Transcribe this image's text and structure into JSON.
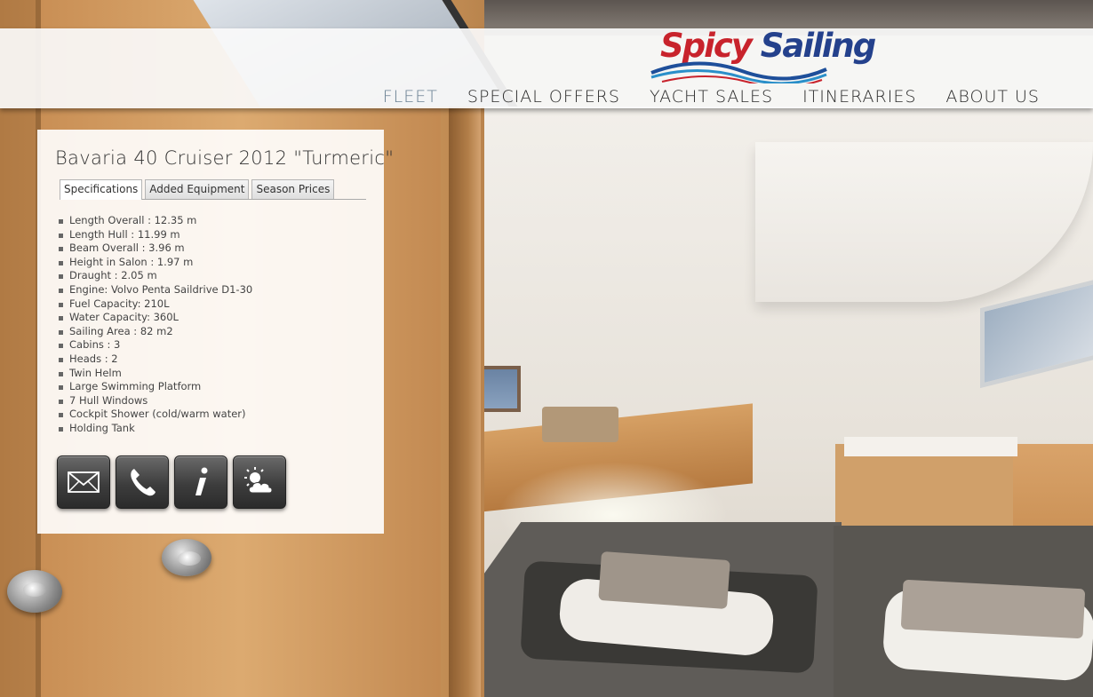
{
  "brand": {
    "part1": "Spicy",
    "part2": "Sailing",
    "colors": {
      "red": "#c8232c",
      "blue": "#24418c"
    }
  },
  "nav": {
    "items": [
      {
        "label": "FLEET",
        "active": true
      },
      {
        "label": "SPECIAL OFFERS"
      },
      {
        "label": "YACHT SALES"
      },
      {
        "label": "ITINERARIES"
      },
      {
        "label": "ABOUT US"
      }
    ]
  },
  "panel": {
    "title": "Bavaria 40 Cruiser 2012 \"Turmeric\"",
    "tabs": [
      {
        "label": "Specifications",
        "active": true
      },
      {
        "label": "Added Equipment"
      },
      {
        "label": "Season Prices"
      }
    ],
    "specs": [
      "Length Overall : 12.35 m",
      "Length Hull : 11.99 m",
      "Beam Overall : 3.96 m",
      "Height in Salon : 1.97 m",
      "Draught : 2.05 m",
      "Engine: Volvo Penta Saildrive D1-30",
      "Fuel Capacity: 210L",
      "Water Capacity: 360L",
      "Sailing Area : 82 m2",
      "Cabins : 3",
      "Heads : 2",
      "Twin Helm",
      "Large Swimming Platform",
      "7 Hull Windows",
      "Cockpit Shower (cold/warm water)",
      "Holding Tank"
    ],
    "actions": [
      {
        "icon": "envelope-icon"
      },
      {
        "icon": "phone-icon"
      },
      {
        "icon": "info-icon"
      },
      {
        "icon": "weather-icon"
      }
    ]
  }
}
